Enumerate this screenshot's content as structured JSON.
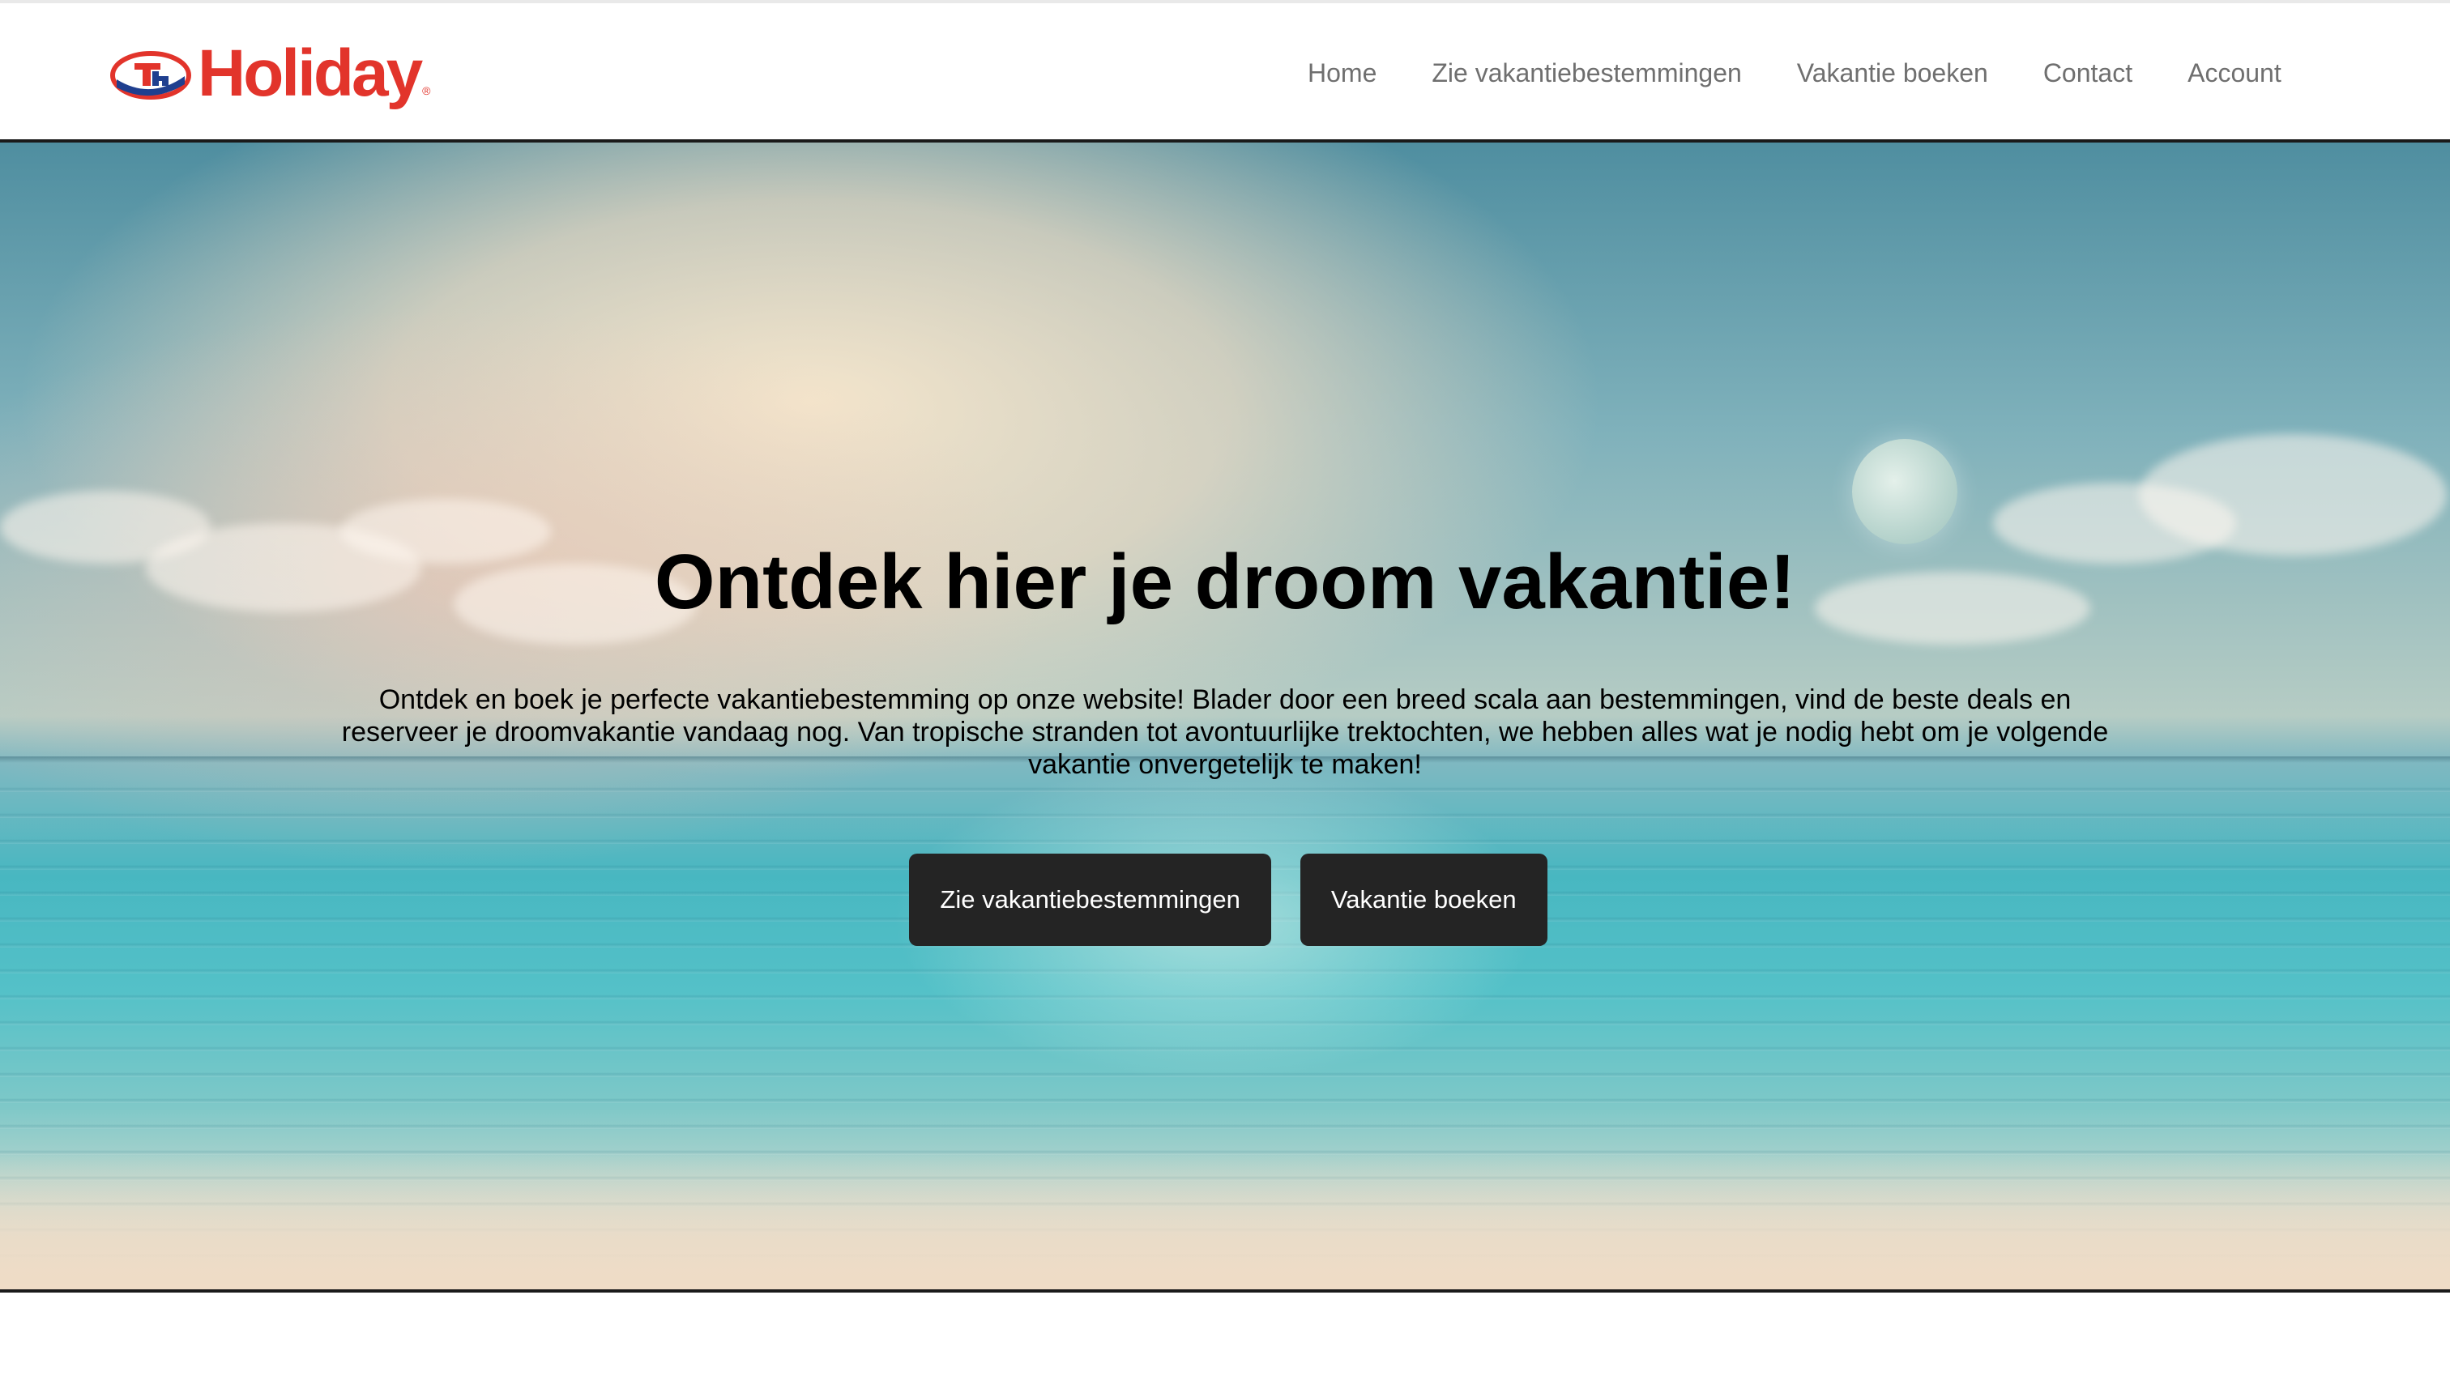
{
  "brand": {
    "name": "Holiday",
    "registered_mark": "®",
    "color": "#e2342b",
    "accent_blue": "#1f3f8f"
  },
  "nav": {
    "items": [
      {
        "label": "Home"
      },
      {
        "label": "Zie vakantiebestemmingen"
      },
      {
        "label": "Vakantie boeken"
      },
      {
        "label": "Contact"
      },
      {
        "label": "Account"
      }
    ]
  },
  "hero": {
    "title": "Ontdek hier je droom vakantie!",
    "text": "Ontdek en boek je perfecte vakantiebestemming op onze website! Blader door een breed scala aan bestemmingen, vind de beste deals en reserveer je droomvakantie vandaag nog. Van tropische stranden tot avontuurlijke trektochten, we hebben alles wat je nodig hebt om je volgende vakantie onvergetelijk te maken!",
    "buttons": [
      {
        "label": "Zie vakantiebestemmingen"
      },
      {
        "label": "Vakantie boeken"
      }
    ],
    "button_color": "#242424"
  }
}
